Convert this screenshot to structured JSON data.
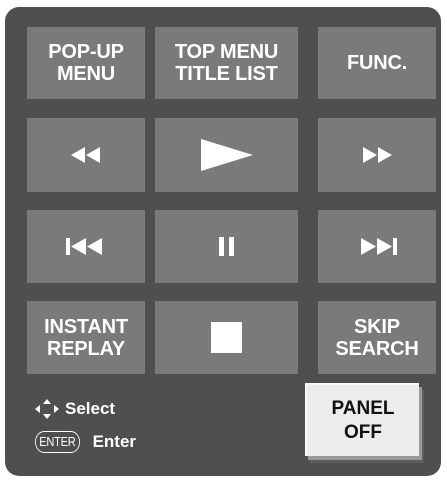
{
  "buttons": {
    "popup_menu": [
      "POP-UP",
      "MENU"
    ],
    "top_menu": [
      "TOP MENU",
      "TITLE LIST"
    ],
    "func": "FUNC.",
    "rewind_icon": "rewind-icon",
    "play_icon": "play-icon",
    "fast_forward_icon": "fast-forward-icon",
    "skip_back_icon": "skip-back-icon",
    "pause_icon": "pause-icon",
    "skip_forward_icon": "skip-forward-icon",
    "instant_replay": [
      "INSTANT",
      "REPLAY"
    ],
    "stop_icon": "stop-icon",
    "skip_search": [
      "SKIP",
      "SEARCH"
    ],
    "panel_off": [
      "PANEL",
      "OFF"
    ]
  },
  "legend": {
    "select_label": "Select",
    "enter_badge": "ENTER",
    "enter_label": "Enter"
  },
  "colors": {
    "panel_background": "#4f4f4f",
    "button_background": "#7a7a7a",
    "button_text": "#ffffff",
    "highlight_button_background": "#ececec",
    "highlight_button_text": "#111111"
  }
}
